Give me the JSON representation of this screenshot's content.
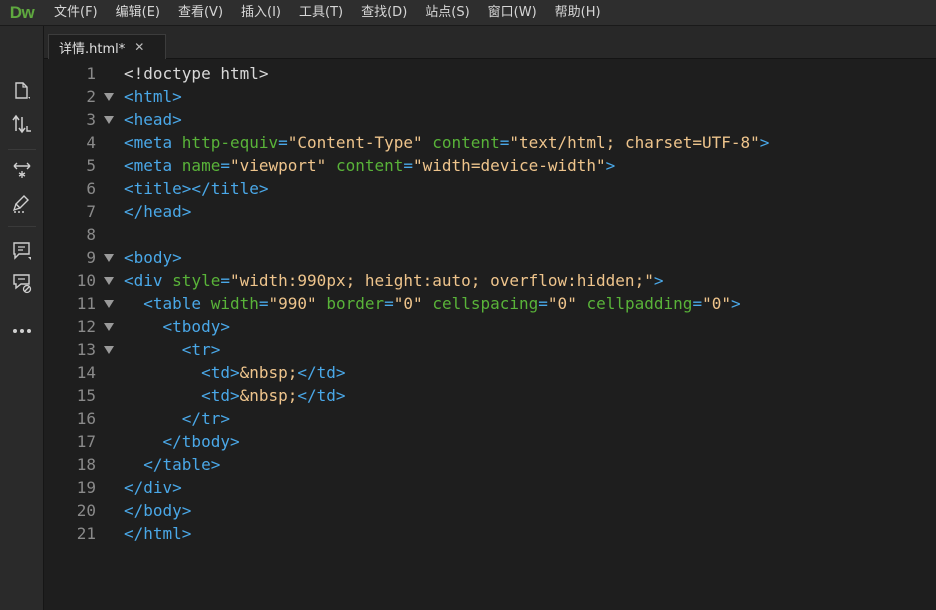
{
  "app": {
    "logo": "Dw"
  },
  "menu": [
    {
      "id": "file",
      "label": "文件(F)"
    },
    {
      "id": "edit",
      "label": "编辑(E)"
    },
    {
      "id": "view",
      "label": "查看(V)"
    },
    {
      "id": "insert",
      "label": "插入(I)"
    },
    {
      "id": "tools",
      "label": "工具(T)"
    },
    {
      "id": "find",
      "label": "查找(D)"
    },
    {
      "id": "site",
      "label": "站点(S)"
    },
    {
      "id": "window",
      "label": "窗口(W)"
    },
    {
      "id": "help",
      "label": "帮助(H)"
    }
  ],
  "toolbar": {
    "buttons": [
      {
        "name": "open-documents-icon"
      },
      {
        "name": "file-management-icon"
      },
      {
        "name": "expand-all-icon"
      },
      {
        "name": "format-source-icon"
      },
      {
        "name": "apply-comment-icon"
      },
      {
        "name": "remove-comment-icon"
      },
      {
        "name": "more-options-icon"
      }
    ]
  },
  "tabs": [
    {
      "label": "详情.html*",
      "close": "✕",
      "active": true
    }
  ],
  "editor": {
    "colors": {
      "tag": "#4aa8e8",
      "attr": "#59b339",
      "string": "#eec48c",
      "text": "#d8d8d8",
      "line_number": "#8a8a8a"
    },
    "lines": [
      {
        "n": "1",
        "fold": false,
        "tokens": [
          [
            "text",
            "<!doctype html>"
          ]
        ]
      },
      {
        "n": "2",
        "fold": true,
        "tokens": [
          [
            "tag",
            "<html>"
          ]
        ]
      },
      {
        "n": "3",
        "fold": true,
        "tokens": [
          [
            "tag",
            "<head>"
          ]
        ]
      },
      {
        "n": "4",
        "fold": false,
        "tokens": [
          [
            "tag",
            "<meta "
          ],
          [
            "attr",
            "http-equiv"
          ],
          [
            "tag",
            "="
          ],
          [
            "str",
            "\"Content-Type\""
          ],
          [
            "tag",
            " "
          ],
          [
            "attr",
            "content"
          ],
          [
            "tag",
            "="
          ],
          [
            "str",
            "\"text/html; charset=UTF-8\""
          ],
          [
            "tag",
            ">"
          ]
        ]
      },
      {
        "n": "5",
        "fold": false,
        "tokens": [
          [
            "tag",
            "<meta "
          ],
          [
            "attr",
            "name"
          ],
          [
            "tag",
            "="
          ],
          [
            "str",
            "\"viewport\""
          ],
          [
            "tag",
            " "
          ],
          [
            "attr",
            "content"
          ],
          [
            "tag",
            "="
          ],
          [
            "str",
            "\"width=device-width\""
          ],
          [
            "tag",
            ">"
          ]
        ]
      },
      {
        "n": "6",
        "fold": false,
        "tokens": [
          [
            "tag",
            "<title></title>"
          ]
        ]
      },
      {
        "n": "7",
        "fold": false,
        "tokens": [
          [
            "tag",
            "</head>"
          ]
        ]
      },
      {
        "n": "8",
        "fold": false,
        "tokens": []
      },
      {
        "n": "9",
        "fold": true,
        "tokens": [
          [
            "tag",
            "<body>"
          ]
        ]
      },
      {
        "n": "10",
        "fold": true,
        "tokens": [
          [
            "tag",
            "<div "
          ],
          [
            "attr",
            "style"
          ],
          [
            "tag",
            "="
          ],
          [
            "str",
            "\"width:990px; height:auto; overflow:hidden;\""
          ],
          [
            "tag",
            ">"
          ]
        ]
      },
      {
        "n": "11",
        "fold": true,
        "tokens": [
          [
            "tag",
            "  <table "
          ],
          [
            "attr",
            "width"
          ],
          [
            "tag",
            "="
          ],
          [
            "str",
            "\"990\""
          ],
          [
            "tag",
            " "
          ],
          [
            "attr",
            "border"
          ],
          [
            "tag",
            "="
          ],
          [
            "str",
            "\"0\""
          ],
          [
            "tag",
            " "
          ],
          [
            "attr",
            "cellspacing"
          ],
          [
            "tag",
            "="
          ],
          [
            "str",
            "\"0\""
          ],
          [
            "tag",
            " "
          ],
          [
            "attr",
            "cellpadding"
          ],
          [
            "tag",
            "="
          ],
          [
            "str",
            "\"0\""
          ],
          [
            "tag",
            ">"
          ]
        ]
      },
      {
        "n": "12",
        "fold": true,
        "tokens": [
          [
            "tag",
            "    <tbody>"
          ]
        ]
      },
      {
        "n": "13",
        "fold": true,
        "tokens": [
          [
            "tag",
            "      <tr>"
          ]
        ]
      },
      {
        "n": "14",
        "fold": false,
        "tokens": [
          [
            "tag",
            "        <td>"
          ],
          [
            "str",
            "&nbsp;"
          ],
          [
            "tag",
            "</td>"
          ]
        ]
      },
      {
        "n": "15",
        "fold": false,
        "tokens": [
          [
            "tag",
            "        <td>"
          ],
          [
            "str",
            "&nbsp;"
          ],
          [
            "tag",
            "</td>"
          ]
        ]
      },
      {
        "n": "16",
        "fold": false,
        "tokens": [
          [
            "tag",
            "      </tr>"
          ]
        ]
      },
      {
        "n": "17",
        "fold": false,
        "tokens": [
          [
            "tag",
            "    </tbody>"
          ]
        ]
      },
      {
        "n": "18",
        "fold": false,
        "tokens": [
          [
            "tag",
            "  </table>"
          ]
        ]
      },
      {
        "n": "19",
        "fold": false,
        "tokens": [
          [
            "tag",
            "</div>"
          ]
        ]
      },
      {
        "n": "20",
        "fold": false,
        "tokens": [
          [
            "tag",
            "</body>"
          ]
        ]
      },
      {
        "n": "21",
        "fold": false,
        "tokens": [
          [
            "tag",
            "</html>"
          ]
        ]
      }
    ]
  }
}
